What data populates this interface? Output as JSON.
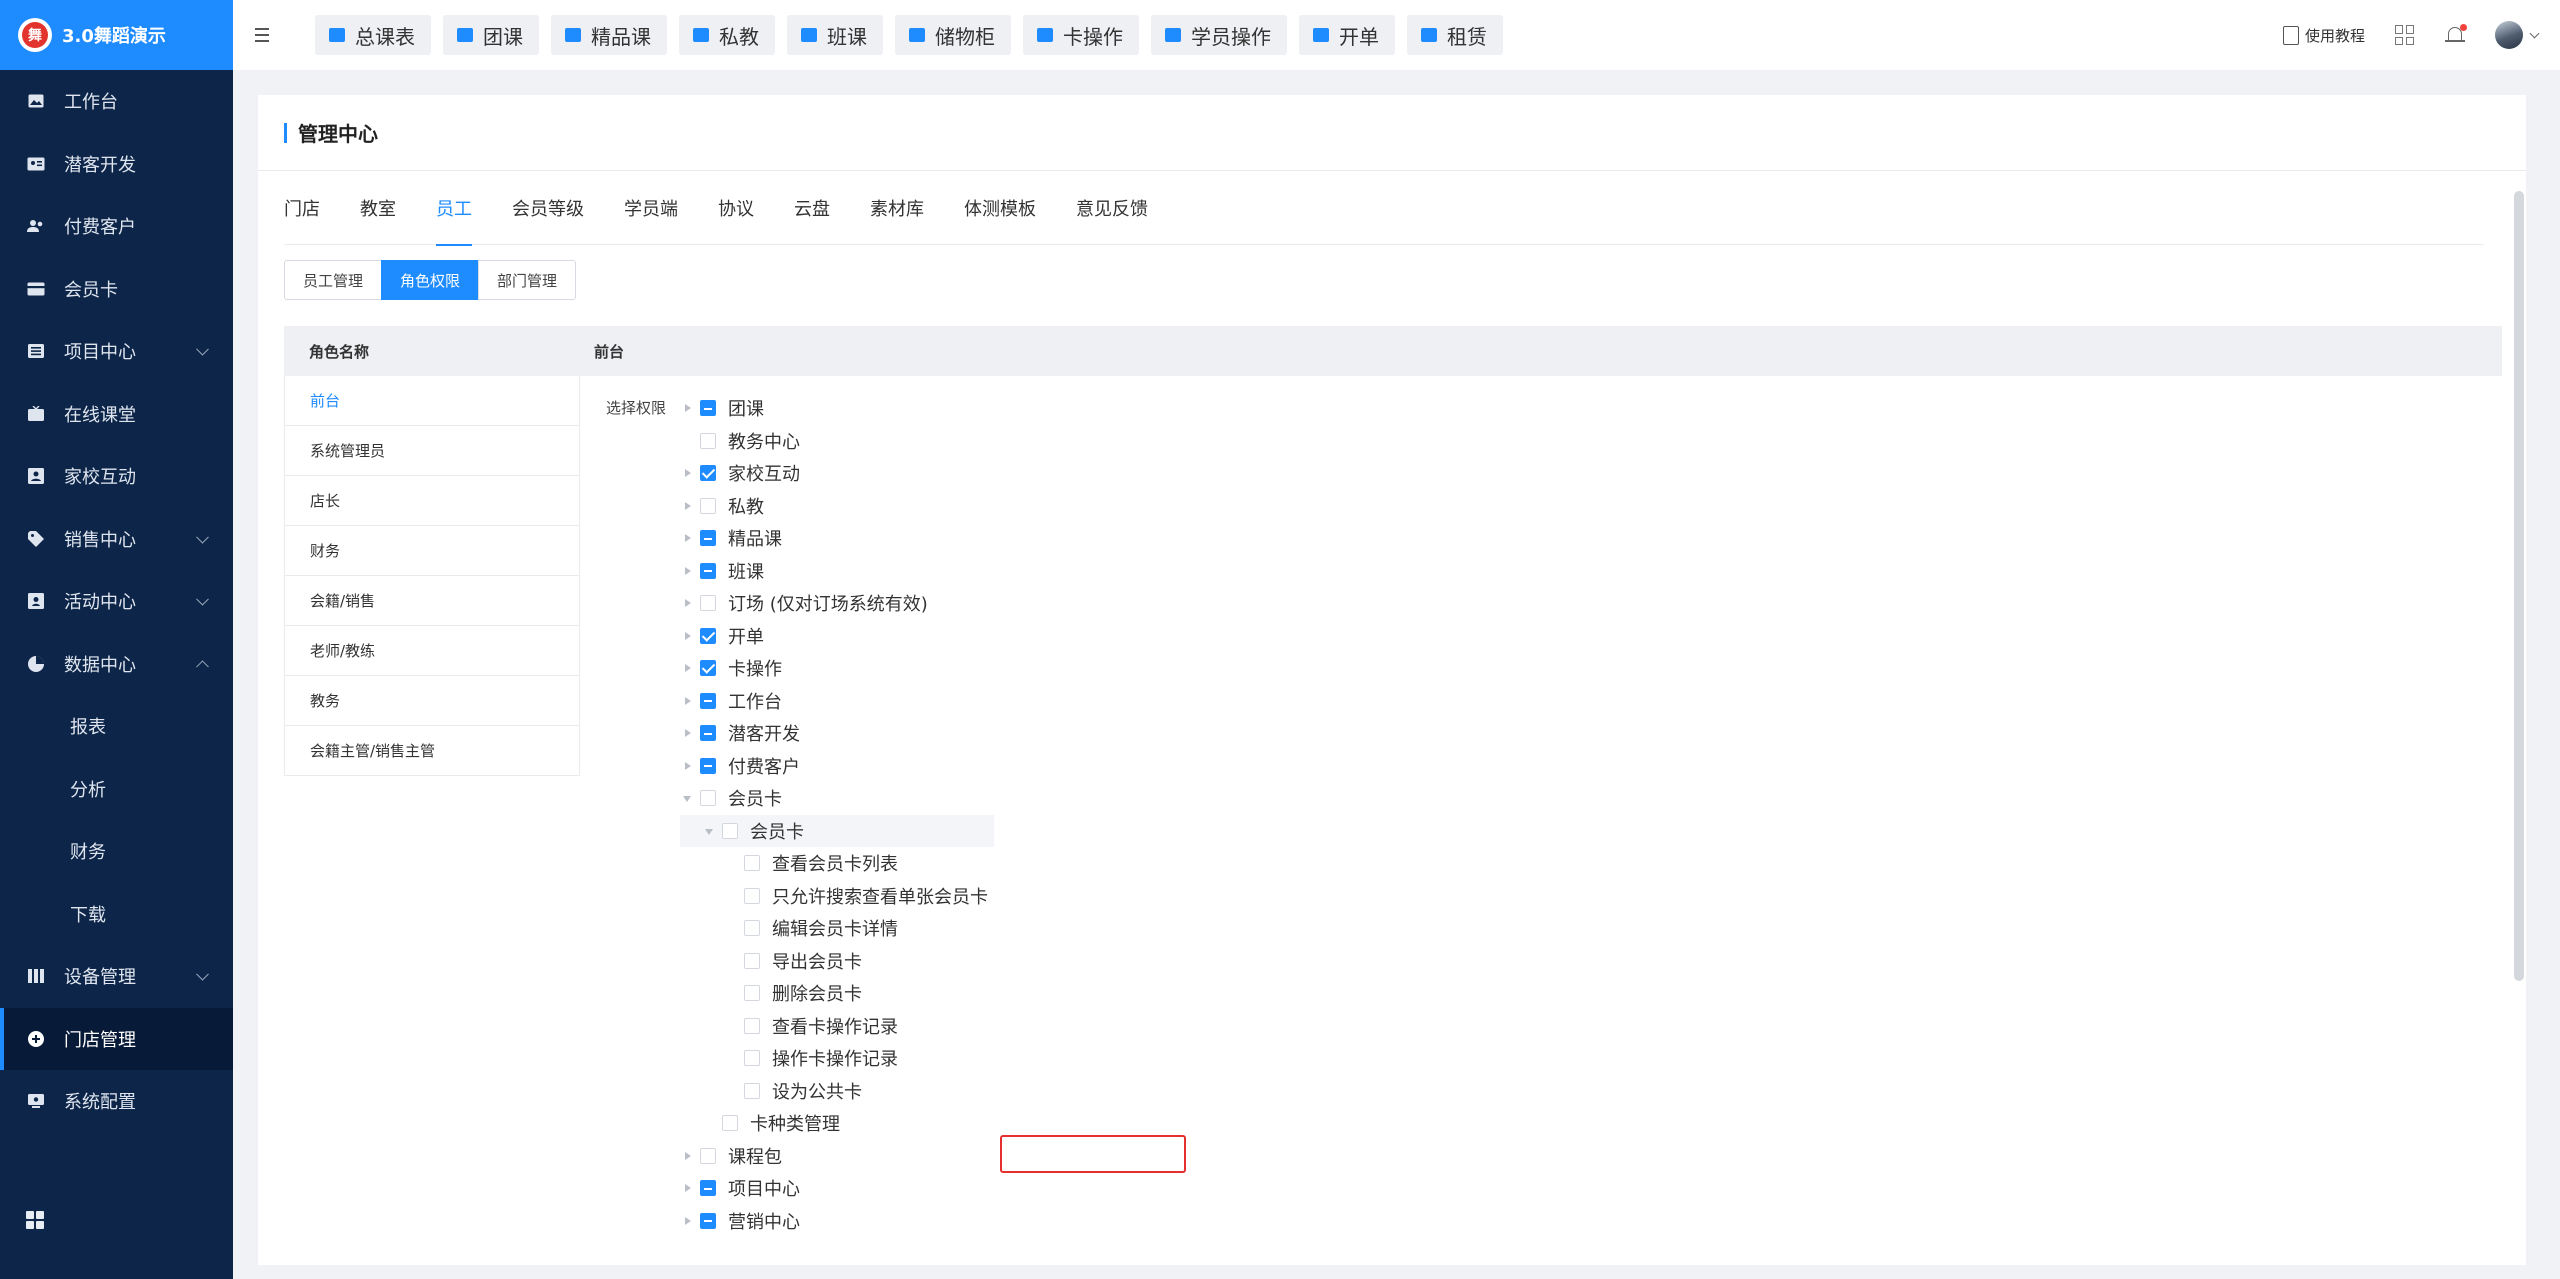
{
  "brand": {
    "name": "3.0舞蹈演示",
    "logo_text": "舞"
  },
  "sidebar": {
    "items": [
      {
        "label": "工作台",
        "icon": "image-icon",
        "chevron": ""
      },
      {
        "label": "潜客开发",
        "icon": "id-card-icon",
        "chevron": ""
      },
      {
        "label": "付费客户",
        "icon": "users-icon",
        "chevron": ""
      },
      {
        "label": "会员卡",
        "icon": "card-icon",
        "chevron": ""
      },
      {
        "label": "项目中心",
        "icon": "list-icon",
        "chevron": "down"
      },
      {
        "label": "在线课堂",
        "icon": "tv-icon",
        "chevron": ""
      },
      {
        "label": "家校互动",
        "icon": "contact-icon",
        "chevron": ""
      },
      {
        "label": "销售中心",
        "icon": "tag-icon",
        "chevron": "down"
      },
      {
        "label": "活动中心",
        "icon": "activity-icon",
        "chevron": "down"
      },
      {
        "label": "数据中心",
        "icon": "pie-chart-icon",
        "chevron": "up"
      },
      {
        "label": "报表",
        "icon": "",
        "chevron": "",
        "sub": true
      },
      {
        "label": "分析",
        "icon": "",
        "chevron": "",
        "sub": true
      },
      {
        "label": "财务",
        "icon": "",
        "chevron": "",
        "sub": true
      },
      {
        "label": "下载",
        "icon": "",
        "chevron": "",
        "sub": true
      },
      {
        "label": "设备管理",
        "icon": "device-icon",
        "chevron": "down"
      },
      {
        "label": "门店管理",
        "icon": "store-icon",
        "chevron": "",
        "active": true
      },
      {
        "label": "系统配置",
        "icon": "settings-icon",
        "chevron": ""
      }
    ]
  },
  "topbar": {
    "quick": [
      "总课表",
      "团课",
      "精品课",
      "私教",
      "班课",
      "储物柜",
      "卡操作",
      "学员操作",
      "开单",
      "租赁"
    ],
    "tutorial": "使用教程"
  },
  "page": {
    "title": "管理中心",
    "tabs": [
      "门店",
      "教室",
      "员工",
      "会员等级",
      "学员端",
      "协议",
      "云盘",
      "素材库",
      "体测模板",
      "意见反馈"
    ],
    "active_tab": "员工",
    "segments": [
      "员工管理",
      "角色权限",
      "部门管理"
    ],
    "active_segment": "角色权限",
    "table": {
      "col1": "角色名称",
      "col2": "前台",
      "roles": [
        "前台",
        "系统管理员",
        "店长",
        "财务",
        "会籍/销售",
        "老师/教练",
        "教务",
        "会籍主管/销售主管"
      ],
      "active_role": "前台",
      "perm_label": "选择权限"
    },
    "tree": [
      {
        "label": "团课",
        "level": 0,
        "arrow": "r",
        "state": "partial"
      },
      {
        "label": "教务中心",
        "level": 0,
        "arrow": "",
        "state": "none"
      },
      {
        "label": "家校互动",
        "level": 0,
        "arrow": "r",
        "state": "checked"
      },
      {
        "label": "私教",
        "level": 0,
        "arrow": "r",
        "state": "none"
      },
      {
        "label": "精品课",
        "level": 0,
        "arrow": "r",
        "state": "partial"
      },
      {
        "label": "班课",
        "level": 0,
        "arrow": "r",
        "state": "partial"
      },
      {
        "label": "订场 (仅对订场系统有效)",
        "level": 0,
        "arrow": "r",
        "state": "none"
      },
      {
        "label": "开单",
        "level": 0,
        "arrow": "r",
        "state": "checked"
      },
      {
        "label": "卡操作",
        "level": 0,
        "arrow": "r",
        "state": "checked"
      },
      {
        "label": "工作台",
        "level": 0,
        "arrow": "r",
        "state": "partial"
      },
      {
        "label": "潜客开发",
        "level": 0,
        "arrow": "r",
        "state": "partial"
      },
      {
        "label": "付费客户",
        "level": 0,
        "arrow": "r",
        "state": "partial"
      },
      {
        "label": "会员卡",
        "level": 0,
        "arrow": "d",
        "state": "none"
      },
      {
        "label": "会员卡",
        "level": 1,
        "arrow": "d",
        "state": "none",
        "hl": true
      },
      {
        "label": "查看会员卡列表",
        "level": 2,
        "arrow": "",
        "state": "none"
      },
      {
        "label": "只允许搜索查看单张会员卡",
        "level": 2,
        "arrow": "",
        "state": "none"
      },
      {
        "label": "编辑会员卡详情",
        "level": 2,
        "arrow": "",
        "state": "none"
      },
      {
        "label": "导出会员卡",
        "level": 2,
        "arrow": "",
        "state": "none"
      },
      {
        "label": "删除会员卡",
        "level": 2,
        "arrow": "",
        "state": "none"
      },
      {
        "label": "查看卡操作记录",
        "level": 2,
        "arrow": "",
        "state": "none"
      },
      {
        "label": "操作卡操作记录",
        "level": 2,
        "arrow": "",
        "state": "none"
      },
      {
        "label": "设为公共卡",
        "level": 2,
        "arrow": "",
        "state": "none"
      },
      {
        "label": "卡种类管理",
        "level": 1,
        "arrow": "",
        "state": "none"
      },
      {
        "label": "课程包",
        "level": 0,
        "arrow": "r",
        "state": "none"
      },
      {
        "label": "项目中心",
        "level": 0,
        "arrow": "r",
        "state": "partial"
      },
      {
        "label": "营销中心",
        "level": 0,
        "arrow": "r",
        "state": "partial"
      }
    ]
  },
  "colors": {
    "accent": "#1e8bff",
    "sidebar_bg": "#0d2548",
    "highlight": "#e5302d"
  }
}
